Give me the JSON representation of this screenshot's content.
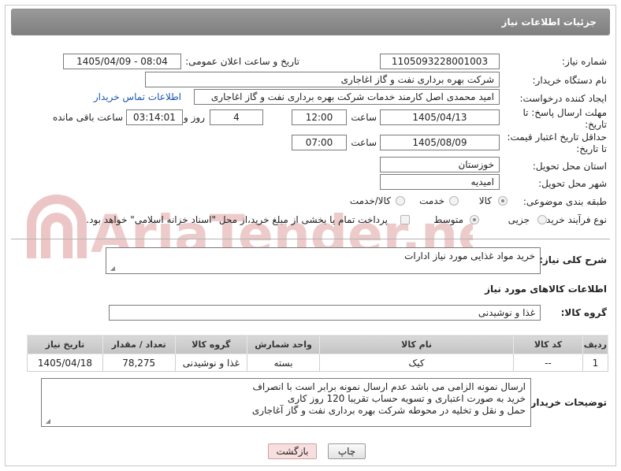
{
  "header": {
    "title": "جزئیات اطلاعات نیاز"
  },
  "form": {
    "need_number_label": "شماره نیاز:",
    "need_number": "1105093228001003",
    "announce_label": "تاریخ و ساعت اعلان عمومی:",
    "announce_value": "1405/04/09 - 08:04",
    "buyer_org_label": "نام دستگاه خریدار:",
    "buyer_org": "شرکت بهره برداری نفت و گاز اغاجاری",
    "creator_label": "ایجاد کننده درخواست:",
    "creator": "امید محمدی اصل کارمند خدمات شرکت بهره برداری نفت و گاز اغاجاری",
    "contact_link": "اطلاعات تماس خریدار",
    "reply_deadline_label_1": "مهلت ارسال پاسخ: تا",
    "reply_deadline_label_2": "تاریخ:",
    "reply_date": "1405/04/13",
    "time_label": "ساعت",
    "reply_time": "12:00",
    "days_value": "4",
    "days_label": "روز و",
    "remaining_time": "03:14:01",
    "remaining_label": "ساعت باقی مانده",
    "price_validity_label_1": "حداقل تاریخ اعتبار قیمت:",
    "price_validity_label_2": "تا تاریخ:",
    "price_date": "1405/08/09",
    "price_time_label": "ساعت",
    "price_time": "07:00",
    "province_label": "استان محل تحویل:",
    "province": "خوزستان",
    "city_label": "شهر محل تحویل:",
    "city": "امیدیه",
    "category_label": "طبقه بندی موضوعی:",
    "category_options": [
      "کالا",
      "خدمت",
      "کالا/خدمت"
    ],
    "category_selected": "کالا",
    "process_label": "نوع فرآیند خرید :",
    "process_options": [
      "جزیی",
      "متوسط"
    ],
    "process_selected": "متوسط",
    "payment_note": "پرداخت تمام یا بخشی از مبلغ خرید،از محل \"اسناد خزانه اسلامی\" خواهد بود."
  },
  "summary": {
    "label": "شرح کلی نیاز:",
    "value": "خرید مواد غذایی مورد نیاز ادارات"
  },
  "goods_section": {
    "title": "اطلاعات کالاهای مورد نیاز",
    "group_label": "گروه کالا:",
    "group_value": "غذا و نوشیدنی"
  },
  "table": {
    "headers": [
      "ردیف",
      "کد کالا",
      "نام کالا",
      "واحد شمارش",
      "گروه کالا",
      "تعداد / مقدار",
      "تاریخ نیاز"
    ],
    "rows": [
      [
        "1",
        "--",
        "کیک",
        "بسته",
        "غذا و نوشیدنی",
        "78,275",
        "1405/04/18"
      ]
    ]
  },
  "buyer_notes": {
    "label": "توضیحات خریدار:",
    "lines": [
      "ارسال نمونه الزامی می باشد عدم ارسال نمونه برابر است با انصراف",
      "خرید به صورت اعتباری و تسویه حساب تقریبا  120 روز کاری",
      "حمل و نقل و تخلیه در محوطه  شرکت بهره برداری نفت و گاز آغاجاری"
    ]
  },
  "buttons": {
    "print": "چاپ",
    "back": "بازگشت"
  },
  "watermark_text": "AriaTender.net",
  "colors": {
    "header": "#8c8c8c",
    "link": "#1a57b0",
    "watermark": "#e6b9b9",
    "back_button": "#f8dede"
  }
}
